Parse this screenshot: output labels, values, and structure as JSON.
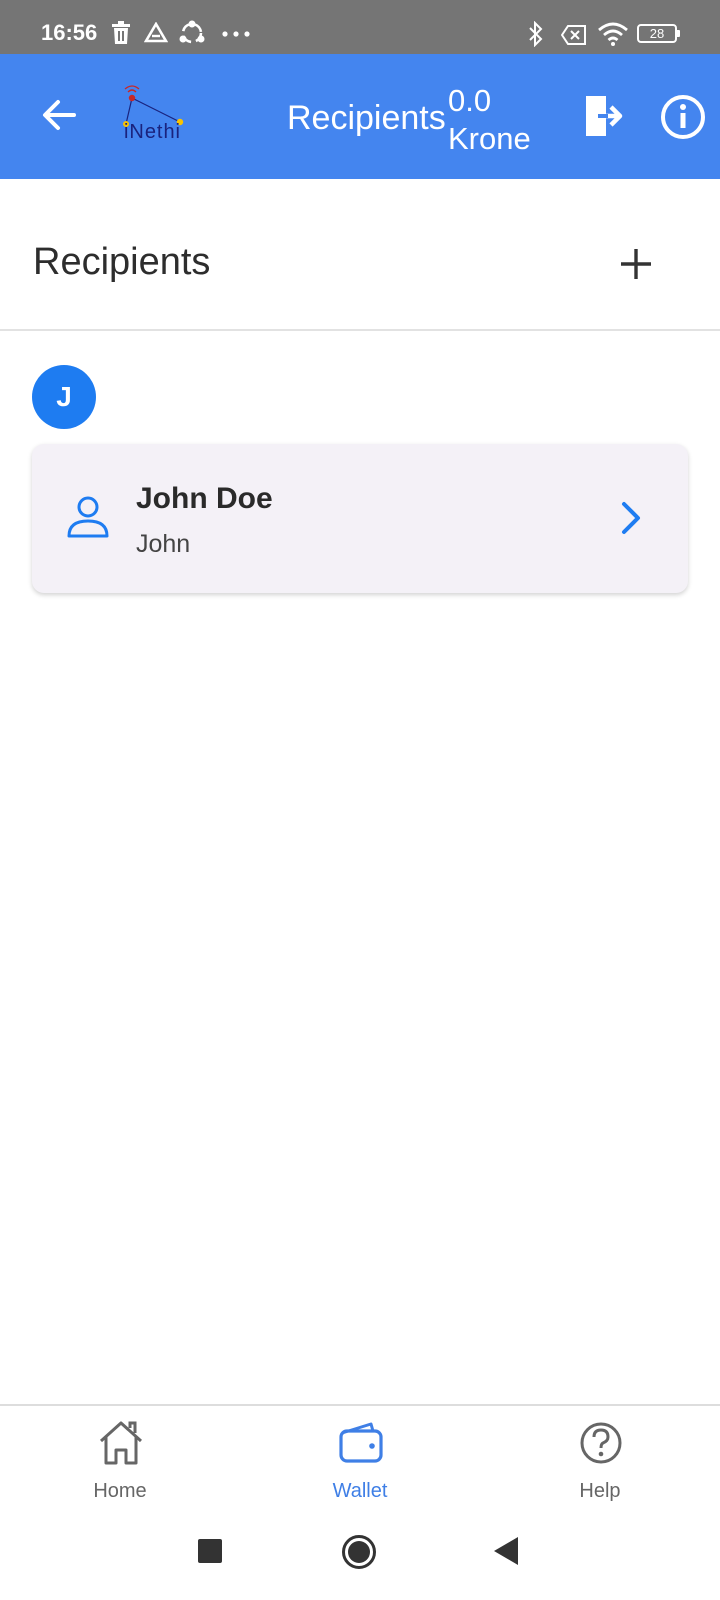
{
  "status_bar": {
    "time": "16:56",
    "battery": "28",
    "icons": [
      "trash-icon",
      "drive-icon",
      "sync-icon",
      "more-dots-icon",
      "bluetooth-icon",
      "no-sim-icon",
      "wifi-icon",
      "battery-icon"
    ]
  },
  "app_bar": {
    "title": "Recipients",
    "balance_amount": "0.0",
    "balance_currency": "Krone",
    "logo_text": "iNethi",
    "background_color": "#4485ef"
  },
  "section": {
    "heading": "Recipients",
    "add_icon": "plus-icon"
  },
  "recipients": {
    "group_letter": "J",
    "items": [
      {
        "name": "John Doe",
        "nickname": "John"
      }
    ]
  },
  "bottom_nav": {
    "items": [
      {
        "label": "Home",
        "icon": "home-icon",
        "active": false
      },
      {
        "label": "Wallet",
        "icon": "wallet-icon",
        "active": true
      },
      {
        "label": "Help",
        "icon": "help-icon",
        "active": false
      }
    ],
    "active_color": "#3f7fe6"
  },
  "system_nav": [
    "recents-square-icon",
    "home-circle-icon",
    "back-triangle-icon"
  ]
}
